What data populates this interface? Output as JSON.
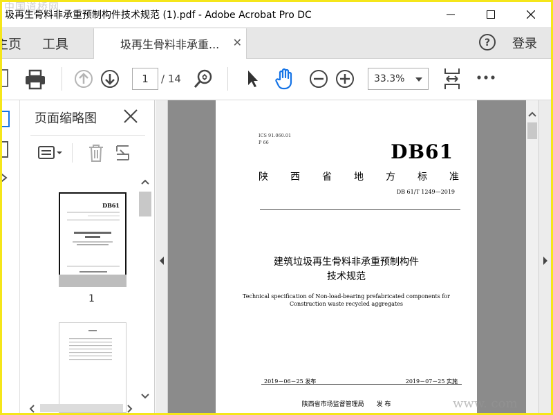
{
  "window": {
    "title": "圾再生骨料非承重预制构件技术规范 (1).pdf - Adobe Acrobat Pro DC"
  },
  "tabs": {
    "home": "主页",
    "tools": "工具",
    "document": "圾再生骨料非承重...",
    "login": "登录"
  },
  "toolbar": {
    "current_page": "1",
    "total_pages": "/ 14",
    "zoom": "33.3%"
  },
  "thumbnails": {
    "title": "页面缩略图",
    "page1_label": "1"
  },
  "document": {
    "ics": "ICS 91.060.01",
    "p": "P 66",
    "db": "DB61",
    "region_chars": [
      "陕",
      "西",
      "省",
      "地",
      "方",
      "标",
      "准"
    ],
    "code": "DB 61/T 1249—2019",
    "cn_title_line1": "建筑垃圾再生骨料非承重预制构件",
    "cn_title_line2": "技术规范",
    "en_title_line1": "Technical specification of Non-load-bearing prefabricated components for",
    "en_title_line2": "Construction waste recycled aggregates",
    "publish_date": "2019－06－25 发布",
    "implement_date": "2019－07－25 实施",
    "issuer": "陕西省市场监督管理局　　发 布"
  },
  "watermarks": {
    "top": "中国道桥网",
    "bottom": "www.      com"
  },
  "colors": {
    "frame": "#f5e61a",
    "hand_tool": "#1473e6",
    "doc_background": "#8b8b8b"
  }
}
